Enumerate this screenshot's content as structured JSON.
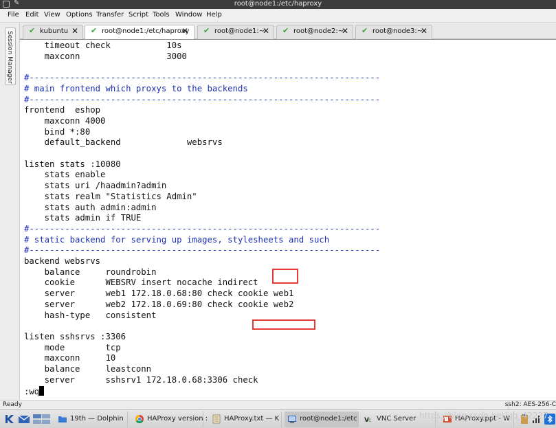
{
  "window": {
    "title": "root@node1:/etc/haproxy"
  },
  "menu": [
    "File",
    "Edit",
    "View",
    "Options",
    "Transfer",
    "Script",
    "Tools",
    "Window",
    "Help"
  ],
  "session_manager": {
    "label": "Session Manager"
  },
  "tabs": [
    {
      "label": "kubuntu",
      "active": false
    },
    {
      "label": "root@node1:/etc/haproxy",
      "active": true
    },
    {
      "label": "root@node1:~",
      "active": false
    },
    {
      "label": "root@node2:~",
      "active": false
    },
    {
      "label": "root@node3:~",
      "active": false
    }
  ],
  "terminal": {
    "lines": [
      {
        "text": "    timeout check           10s",
        "type": "code"
      },
      {
        "text": "    maxconn                 3000",
        "type": "code"
      },
      {
        "text": "",
        "type": "code"
      },
      {
        "text": "#---------------------------------------------------------------------",
        "type": "comment"
      },
      {
        "text": "# main frontend which proxys to the backends",
        "type": "comment"
      },
      {
        "text": "#---------------------------------------------------------------------",
        "type": "comment"
      },
      {
        "text": "frontend  eshop",
        "type": "code"
      },
      {
        "text": "    maxconn 4000",
        "type": "code"
      },
      {
        "text": "    bind *:80",
        "type": "code"
      },
      {
        "text": "    default_backend             websrvs",
        "type": "code"
      },
      {
        "text": "",
        "type": "code"
      },
      {
        "text": "listen stats :10080",
        "type": "code"
      },
      {
        "text": "    stats enable",
        "type": "code"
      },
      {
        "text": "    stats uri /haadmin?admin",
        "type": "code"
      },
      {
        "text": "    stats realm \"Statistics Admin\"",
        "type": "code"
      },
      {
        "text": "    stats auth admin:admin",
        "type": "code"
      },
      {
        "text": "    stats admin if TRUE",
        "type": "code"
      },
      {
        "text": "#---------------------------------------------------------------------",
        "type": "comment"
      },
      {
        "text": "# static backend for serving up images, stylesheets and such",
        "type": "comment"
      },
      {
        "text": "#---------------------------------------------------------------------",
        "type": "comment"
      },
      {
        "text": "backend websrvs",
        "type": "code"
      },
      {
        "text": "    balance     roundrobin",
        "type": "code"
      },
      {
        "text": "    cookie      WEBSRV insert nocache indirect",
        "type": "code"
      },
      {
        "text": "    server      web1 172.18.0.68:80 check cookie web1",
        "type": "code"
      },
      {
        "text": "    server      web2 172.18.0.69:80 check cookie web2",
        "type": "code"
      },
      {
        "text": "    hash-type   consistent",
        "type": "code"
      },
      {
        "text": "",
        "type": "code"
      },
      {
        "text": "listen sshsrvs :3306",
        "type": "code"
      },
      {
        "text": "    mode        tcp",
        "type": "code"
      },
      {
        "text": "    maxconn     10",
        "type": "code"
      },
      {
        "text": "    balance     leastconn",
        "type": "code"
      },
      {
        "text": "    server      sshsrv1 172.18.0.68:3306 check",
        "type": "code"
      }
    ],
    "command": ":wq"
  },
  "annotation_color": "#e53a35",
  "comment_color": "#1c2fb0",
  "status": {
    "left": "Ready",
    "right": "ssh2: AES-256-C"
  },
  "taskbar": {
    "tasks": [
      {
        "label": "19th — Dolphin",
        "icon": "folder-icon"
      },
      {
        "label": "HAProxy version :",
        "icon": "chrome-icon"
      },
      {
        "label": "HAProxy.txt — K",
        "icon": "text-editor-icon"
      },
      {
        "label": "root@node1:/etc",
        "icon": "terminal-icon"
      },
      {
        "label": "VNC Server",
        "icon": "vnc-icon"
      },
      {
        "label": "HAProxy.ppt - W",
        "icon": "presentation-icon"
      }
    ],
    "watermark": "https://blog.csdn.net/qq_42227"
  }
}
